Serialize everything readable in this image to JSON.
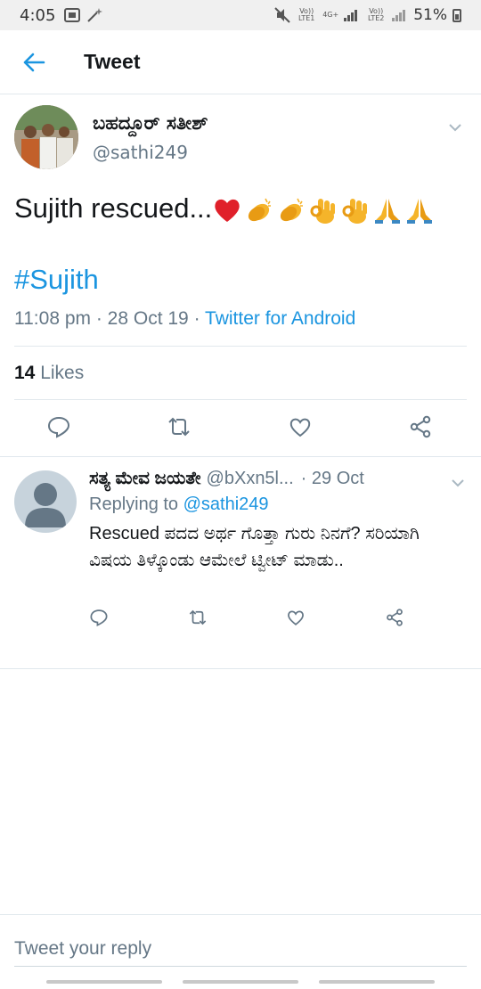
{
  "status_bar": {
    "time": "4:05",
    "net1": "Vo)) LTE1",
    "net_type": "4G+",
    "net2": "Vo)) LTE2",
    "battery": "51%"
  },
  "header": {
    "title": "Tweet"
  },
  "tweet": {
    "author_name": "ಬಹದ್ದೂರ್ ಸತೀಶ್",
    "author_handle": "@sathi249",
    "text": "Sujith rescued...",
    "emojis": [
      "heart",
      "clap",
      "clap",
      "ok-hand",
      "ok-hand",
      "pray",
      "pray"
    ],
    "hashtag": "#Sujith",
    "time": "11:08 pm",
    "date": "28 Oct 19",
    "source": "Twitter for Android",
    "likes_count": "14",
    "likes_label": "Likes"
  },
  "reply": {
    "name": "ಸತ್ಯ ಮೇವ ಜಯತೇ",
    "handle": "@bXxn5l...",
    "date": "· 29 Oct",
    "replying_prefix": "Replying to",
    "replying_to": "@sathi249",
    "text": "Rescued ಪದದ ಅರ್ಥ ಗೊತ್ತಾ ಗುರು ನಿನಗೆ? ಸರಿಯಾಗಿ ವಿಷಯ ತಿಳ್ಕೊಂಡು ಆಮೇಲೆ ಟ್ವೀಟ್ ಮಾಡು.."
  },
  "compose": {
    "placeholder": "Tweet your reply"
  },
  "colors": {
    "accent": "#1b95e0",
    "muted": "#657786",
    "divider": "#e1e8ed"
  }
}
